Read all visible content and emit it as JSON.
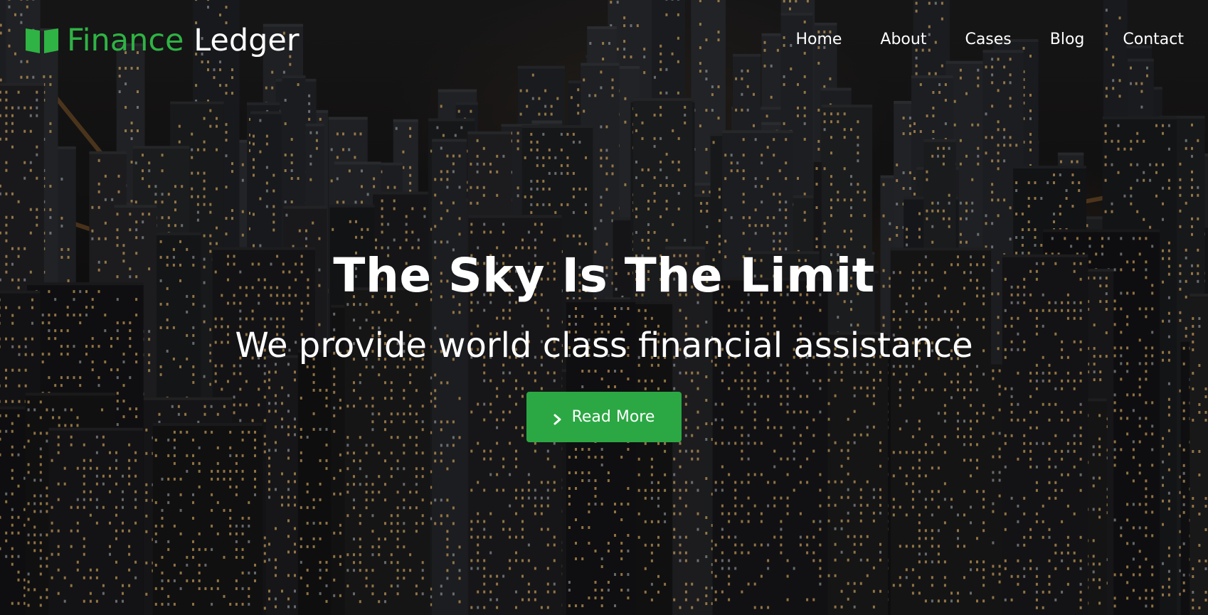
{
  "brand": {
    "accent": "Finance",
    "rest": "Ledger",
    "icon": "open-book-icon",
    "accent_color": "#2fb344"
  },
  "nav": {
    "items": [
      {
        "label": "Home"
      },
      {
        "label": "About"
      },
      {
        "label": "Cases"
      },
      {
        "label": "Blog"
      },
      {
        "label": "Contact"
      }
    ]
  },
  "hero": {
    "title": "The Sky Is The Limit",
    "subtitle": "We provide world class financial assistance",
    "background": "night-city-aerial-photo"
  },
  "cta": {
    "label": "Read More",
    "icon": "chevron-right-icon",
    "color": "#2ba843"
  }
}
